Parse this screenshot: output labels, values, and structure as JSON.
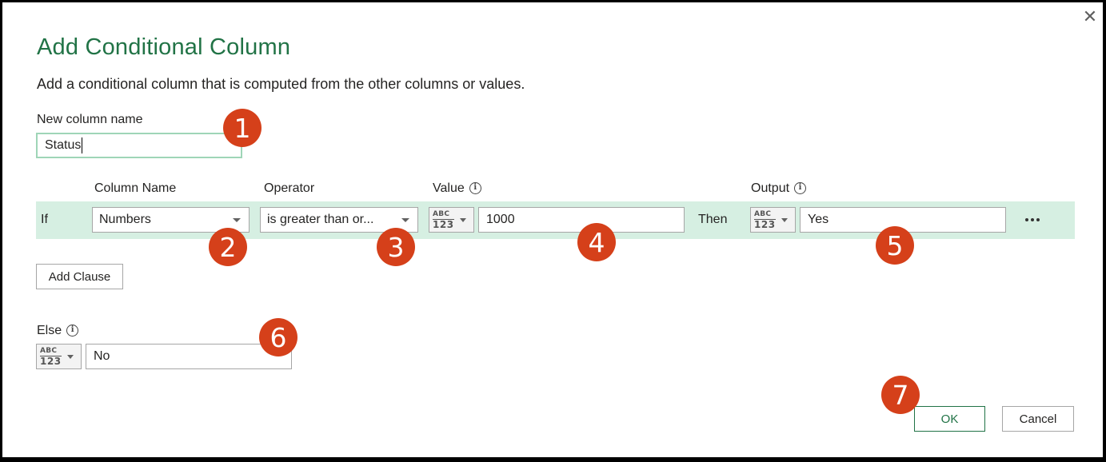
{
  "dialog": {
    "close_glyph": "✕",
    "title": "Add Conditional Column",
    "subtitle": "Add a conditional column that is computed from the other columns or values."
  },
  "new_column": {
    "label": "New column name",
    "value": "Status"
  },
  "clause_headers": {
    "column_name": "Column Name",
    "operator": "Operator",
    "value": "Value",
    "output": "Output"
  },
  "clause": {
    "if_label": "If",
    "column_value": "Numbers",
    "operator_value": "is greater than or...",
    "value_type_top": "ABC",
    "value_type_bottom": "123",
    "value": "1000",
    "then_label": "Then",
    "output_type_top": "ABC",
    "output_type_bottom": "123",
    "output": "Yes",
    "more_icon": "ellipsis-icon"
  },
  "add_clause_label": "Add Clause",
  "else": {
    "label": "Else",
    "type_top": "ABC",
    "type_bottom": "123",
    "value": "No"
  },
  "info_glyph": "i",
  "buttons": {
    "ok": "OK",
    "cancel": "Cancel"
  },
  "annotations": [
    "1",
    "2",
    "3",
    "4",
    "5",
    "6",
    "7"
  ],
  "colors": {
    "title_green": "#217346",
    "clause_band": "#d6efe2",
    "badge_red": "#d5401a"
  }
}
